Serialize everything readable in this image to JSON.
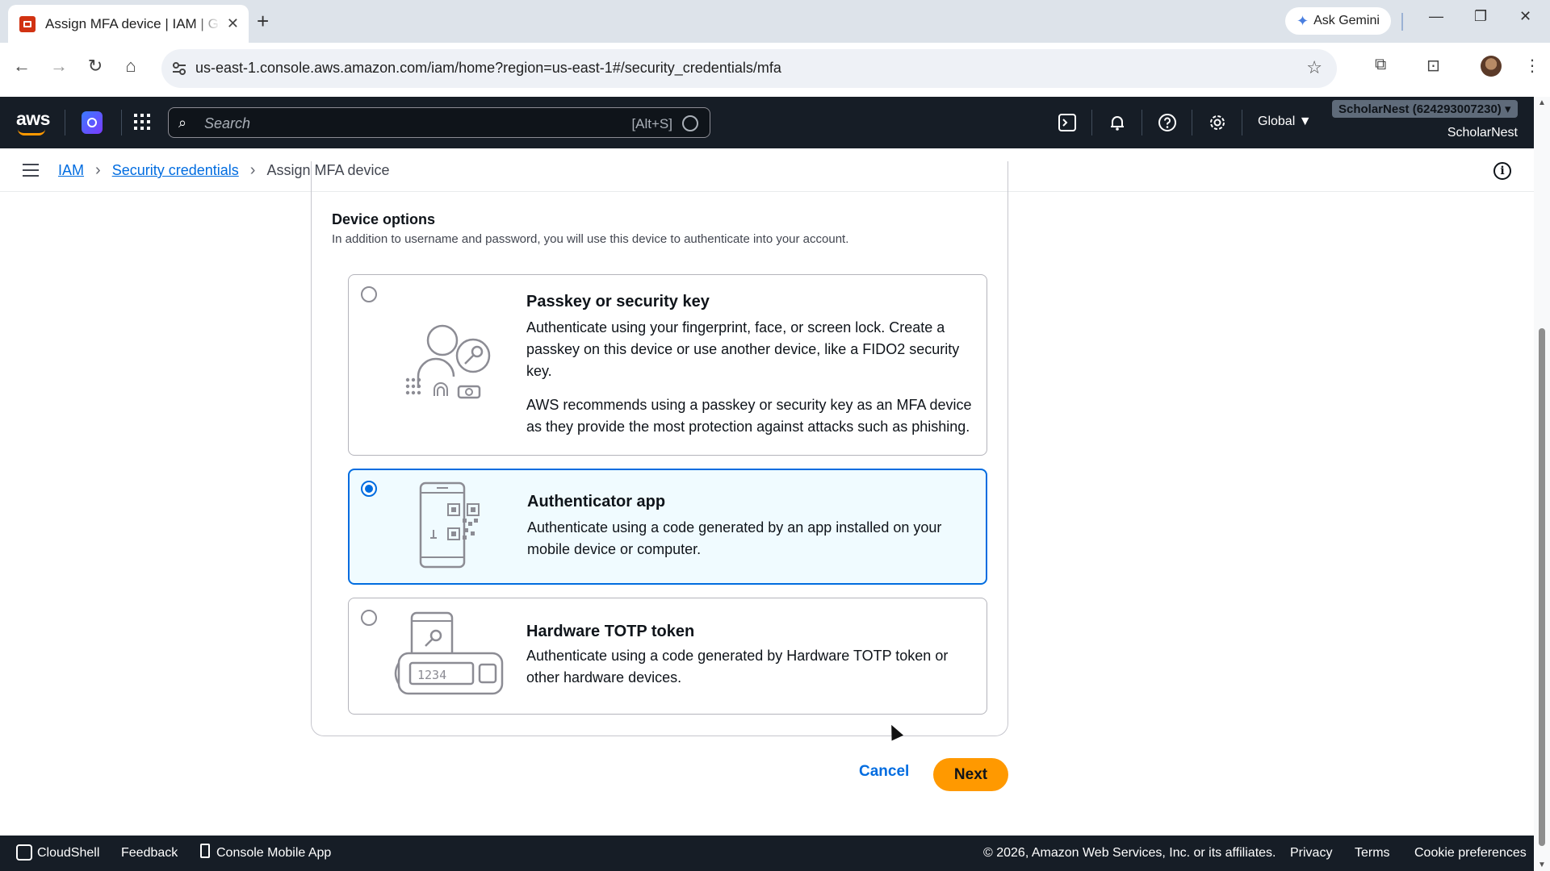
{
  "browser": {
    "tab_title": "Assign MFA device | IAM | Global",
    "new_tab": "+",
    "ask_gemini": "Ask Gemini",
    "url": "us-east-1.console.aws.amazon.com/iam/home?region=us-east-1#/security_credentials/mfa"
  },
  "aws_header": {
    "logo": "aws",
    "search_placeholder": "Search",
    "search_shortcut": "[Alt+S]",
    "region": "Global ▼",
    "account_id": "ScholarNest (624293007230) ▾",
    "account_name": "ScholarNest"
  },
  "breadcrumb": {
    "items": [
      "IAM",
      "Security credentials"
    ],
    "current": "Assign MFA device"
  },
  "device_options": {
    "title": "Device options",
    "description": "In addition to username and password, you will use this device to authenticate into your account.",
    "selected": "Authenticator app",
    "options": [
      {
        "title": "Passkey or security key",
        "description": "Authenticate using your fingerprint, face, or screen lock. Create a passkey on this device or use another device, like a FIDO2 security key.",
        "note": "AWS recommends using a passkey or security key as an MFA device as they provide the most protection against attacks such as phishing."
      },
      {
        "title": "Authenticator app",
        "description": "Authenticate using a code generated by an app installed on your mobile device or computer."
      },
      {
        "title": "Hardware TOTP token",
        "description": "Authenticate using a code generated by Hardware TOTP token or other hardware devices.",
        "token_display": "1234"
      }
    ]
  },
  "actions": {
    "cancel": "Cancel",
    "next": "Next"
  },
  "footer": {
    "cloudshell": "CloudShell",
    "feedback": "Feedback",
    "mobile_app": "Console Mobile App",
    "copyright": "© 2026, Amazon Web Services, Inc. or its affiliates.",
    "privacy": "Privacy",
    "terms": "Terms",
    "cookies": "Cookie preferences"
  },
  "colors": {
    "aws_nav": "#161d26",
    "link_blue": "#006ce0",
    "primary_orange": "#ff9900",
    "selected_bg": "#f0fbff"
  }
}
